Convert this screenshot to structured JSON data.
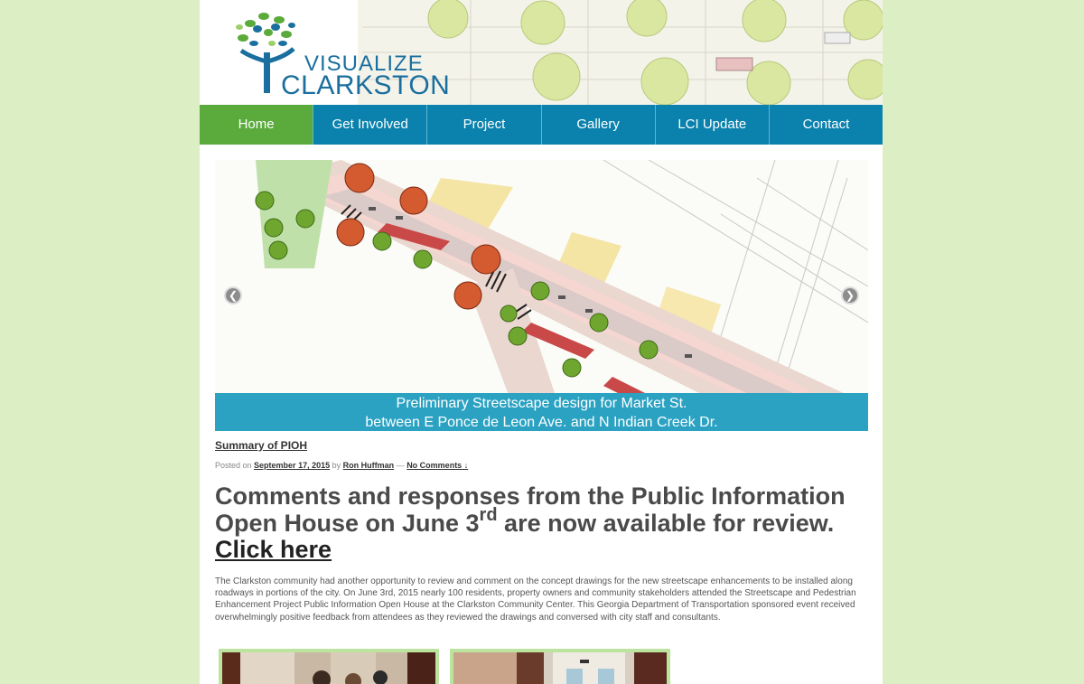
{
  "header": {
    "logo_line1": "VISUALIZE",
    "logo_line2": "CLARKSTON"
  },
  "nav": {
    "items": [
      {
        "label": "Home"
      },
      {
        "label": "Get Involved"
      },
      {
        "label": "Project"
      },
      {
        "label": "Gallery"
      },
      {
        "label": "LCI Update"
      },
      {
        "label": "Contact"
      }
    ]
  },
  "slider": {
    "caption_line1": "Preliminary Streetscape design for Market St.",
    "caption_line2": "between E Ponce de Leon Ave. and N Indian Creek Dr.",
    "prev_icon": "chevron-left-icon",
    "next_icon": "chevron-right-icon"
  },
  "post": {
    "title": "Summary of PIOH",
    "posted_on": "Posted on",
    "date": "September 17, 2015",
    "by": "by",
    "author": "Ron Huffman",
    "dash": "—",
    "comments": "No Comments ↓",
    "headline_part1": "Comments and responses from the Public Information Open House on June 3",
    "headline_sup": "rd",
    "headline_part2": " are now available for review. ",
    "headline_link": "Click here",
    "body": "The Clarkston community had another opportunity to review and comment on the concept drawings for the new streetscape enhancements to be installed along roadways in portions of the city. On June 3rd, 2015 nearly 100 residents, property owners and community stakeholders attended the Streetscape and Pedestrian Enhancement Project Public Information Open House at the Clarkston Community Center. This Georgia Department of Transportation sponsored event received overwhelmingly positive feedback from attendees as they reviewed the drawings and conversed with city staff and consultants."
  },
  "colors": {
    "background": "#dcefc4",
    "nav": "#0a82ad",
    "nav_active": "#5aab3b",
    "caption": "#2ba2c2",
    "logo_blue": "#1a6f9e"
  }
}
